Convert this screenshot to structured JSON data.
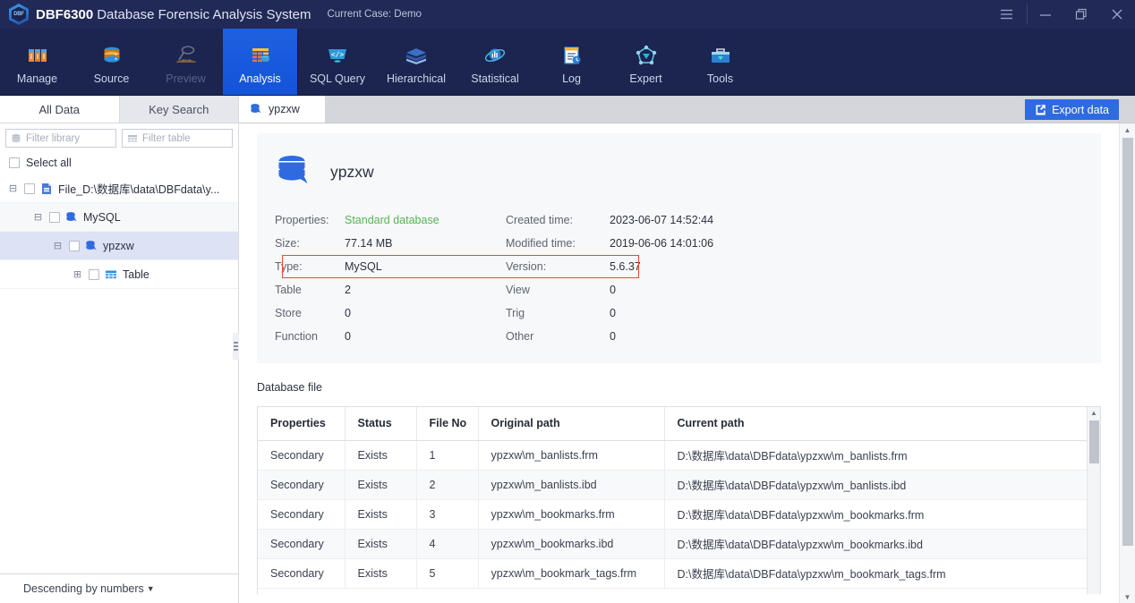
{
  "titlebar": {
    "app_name": "DBF6300",
    "app_subtitle": "Database Forensic Analysis System",
    "case_label": "Current Case: Demo",
    "logo_text": "DBF",
    "menu_icon": "hamburger-menu-icon",
    "minimize_icon": "minimize-icon",
    "restore_icon": "restore-window-icon",
    "close_icon": "close-icon",
    "bg_color": "#212a56"
  },
  "toolbar": {
    "active_index": 3,
    "accent_color": "#1f5fe0",
    "items": [
      {
        "label": "Manage",
        "icon": "archive-boxes-icon",
        "state": "normal"
      },
      {
        "label": "Source",
        "icon": "database-icon",
        "state": "normal"
      },
      {
        "label": "Preview",
        "icon": "magnifier-dig-icon",
        "state": "disabled"
      },
      {
        "label": "Analysis",
        "icon": "analysis-grid-icon",
        "state": "active"
      },
      {
        "label": "SQL Query",
        "icon": "sql-code-icon",
        "state": "normal"
      },
      {
        "label": "Hierarchical",
        "icon": "layers-book-icon",
        "state": "normal"
      },
      {
        "label": "Statistical",
        "icon": "chart-orbit-icon",
        "state": "normal"
      },
      {
        "label": "Log",
        "icon": "log-clock-icon",
        "state": "normal"
      },
      {
        "label": "Expert",
        "icon": "network-node-icon",
        "state": "normal"
      },
      {
        "label": "Tools",
        "icon": "toolbox-icon",
        "state": "normal"
      }
    ]
  },
  "sidebar": {
    "tabs": [
      {
        "label": "All Data",
        "active": true
      },
      {
        "label": "Key Search",
        "active": false
      }
    ],
    "filters": [
      {
        "placeholder": "Filter library",
        "icon": "database-icon",
        "value": ""
      },
      {
        "placeholder": "Filter table",
        "icon": "table-grid-icon",
        "value": ""
      }
    ],
    "select_all_label": "Select all",
    "select_all_checked": false,
    "tree": [
      {
        "label": "File_D:\\数据库\\data\\DBFdata\\y...",
        "icon": "file-db-icon",
        "indent": 0,
        "expander": "collapse",
        "checked": false,
        "selected": false,
        "alt": false
      },
      {
        "label": "MySQL",
        "icon": "mysql-db-icon",
        "indent": 1,
        "expander": "collapse",
        "checked": false,
        "selected": false,
        "alt": true
      },
      {
        "label": "ypzxw",
        "icon": "mysql-db-icon",
        "indent": 2,
        "expander": "collapse",
        "checked": false,
        "selected": true,
        "alt": false
      },
      {
        "label": "Table",
        "icon": "table-grid-icon",
        "indent": 3,
        "expander": "expand",
        "checked": false,
        "selected": false,
        "alt": false
      }
    ],
    "footer_sort_label": "Descending by numbers",
    "footer_sort_icon": "chevron-down-icon"
  },
  "main": {
    "tabs": [
      {
        "label": "ypzxw",
        "icon": "mysql-db-icon",
        "active": true
      }
    ],
    "export_button": {
      "label": "Export data",
      "icon": "export-icon",
      "color": "#2f6be0"
    },
    "database": {
      "name": "ypzxw",
      "icon": "mysql-db-icon",
      "rows": [
        {
          "k": "Properties:",
          "v": "Standard database",
          "v_color": "#54b552",
          "k2": "Created time:",
          "v2": "2023-06-07 14:52:44",
          "highlight": false
        },
        {
          "k": "Size:",
          "v": "77.14 MB",
          "v_color": "",
          "k2": "Modified time:",
          "v2": "2019-06-06 14:01:06",
          "highlight": false
        },
        {
          "k": "Type:",
          "v": "MySQL",
          "v_color": "",
          "k2": "Version:",
          "v2": "5.6.37",
          "highlight": true
        },
        {
          "k": "Table",
          "v": "2",
          "v_color": "",
          "k2": "View",
          "v2": "0",
          "highlight": false
        },
        {
          "k": "Store",
          "v": "0",
          "v_color": "",
          "k2": "Trig",
          "v2": "0",
          "highlight": false
        },
        {
          "k": "Function",
          "v": "0",
          "v_color": "",
          "k2": "Other",
          "v2": "0",
          "highlight": false
        }
      ],
      "highlight_color": "#f2453d"
    },
    "db_file_section_title": "Database file",
    "table": {
      "columns": [
        "Properties",
        "Status",
        "File No",
        "Original path",
        "Current path"
      ],
      "rows": [
        [
          "Secondary",
          "Exists",
          "1",
          "ypzxw\\m_banlists.frm",
          "D:\\数据库\\data\\DBFdata\\ypzxw\\m_banlists.frm"
        ],
        [
          "Secondary",
          "Exists",
          "2",
          "ypzxw\\m_banlists.ibd",
          "D:\\数据库\\data\\DBFdata\\ypzxw\\m_banlists.ibd"
        ],
        [
          "Secondary",
          "Exists",
          "3",
          "ypzxw\\m_bookmarks.frm",
          "D:\\数据库\\data\\DBFdata\\ypzxw\\m_bookmarks.frm"
        ],
        [
          "Secondary",
          "Exists",
          "4",
          "ypzxw\\m_bookmarks.ibd",
          "D:\\数据库\\data\\DBFdata\\ypzxw\\m_bookmarks.ibd"
        ],
        [
          "Secondary",
          "Exists",
          "5",
          "ypzxw\\m_bookmark_tags.frm",
          "D:\\数据库\\data\\DBFdata\\ypzxw\\m_bookmark_tags.frm"
        ]
      ]
    }
  }
}
